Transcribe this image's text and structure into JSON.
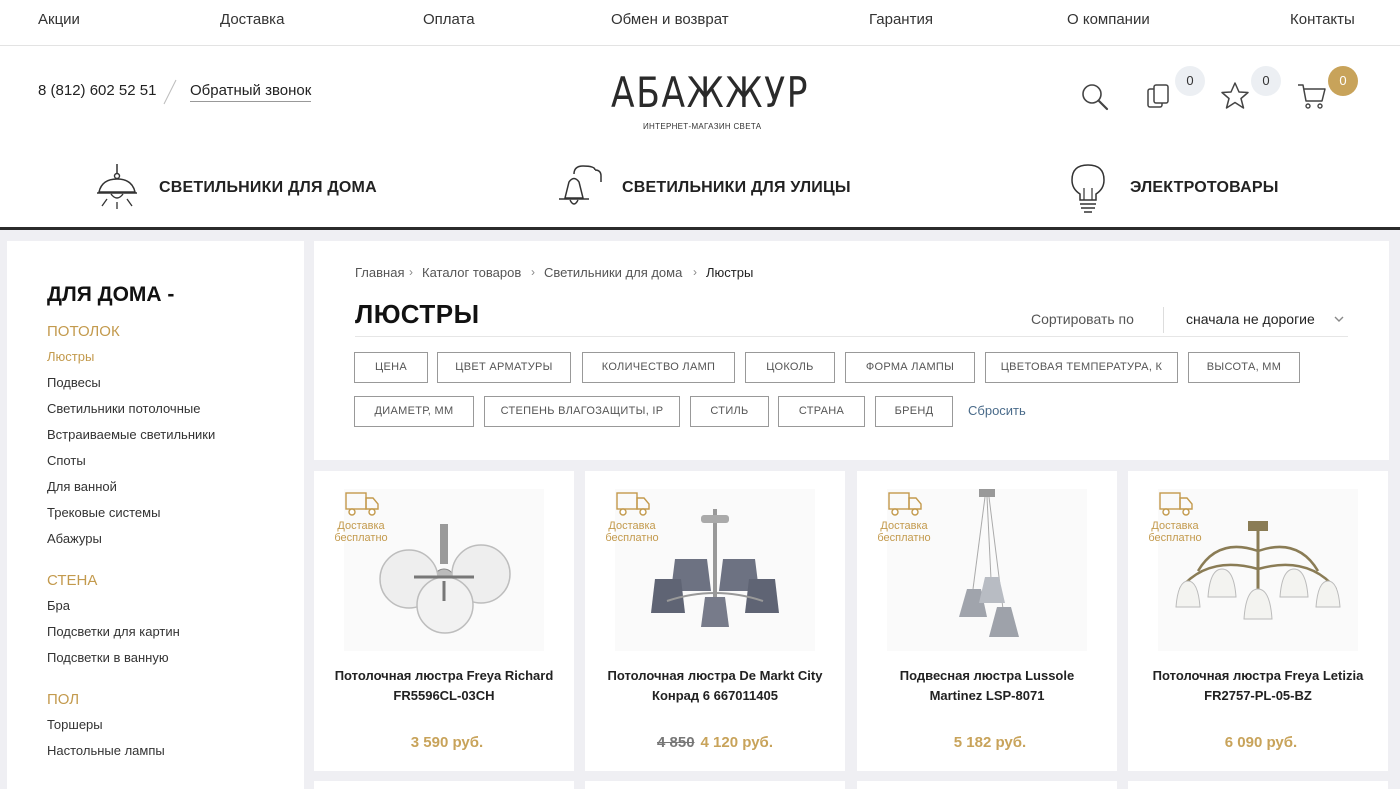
{
  "topnav": [
    "Акции",
    "Доставка",
    "Оплата",
    "Обмен и возврат",
    "Гарантия",
    "О компании",
    "Контакты"
  ],
  "header": {
    "phone": "8 (812) 602 52 51",
    "callback": "Обратный звонок",
    "logo_title": "АБАЖЖУР",
    "logo_subtitle": "ИНТЕРНЕТ-МАГАЗИН СВЕТА",
    "compare_count": "0",
    "favorites_count": "0",
    "cart_count": "0"
  },
  "categories": [
    "СВЕТИЛЬНИКИ ДЛЯ ДОМА",
    "СВЕТИЛЬНИКИ ДЛЯ УЛИЦЫ",
    "ЭЛЕКТРОТОВАРЫ"
  ],
  "sidebar": {
    "title": "ДЛЯ ДОМА  -",
    "sections": [
      {
        "title": "ПОТОЛОК",
        "items": [
          "Люстры",
          "Подвесы",
          "Светильники потолочные",
          "Встраиваемые светильники",
          "Споты",
          "Для ванной",
          "Трековые системы",
          "Абажуры"
        ]
      },
      {
        "title": "СТЕНА",
        "items": [
          "Бра",
          "Подсветки для картин",
          "Подсветки в ванную"
        ]
      },
      {
        "title": "ПОЛ",
        "items": [
          "Торшеры",
          "Настольные лампы"
        ]
      }
    ],
    "active_item": "Люстры"
  },
  "breadcrumbs": [
    "Главная",
    "Каталог товаров",
    "Светильники для дома",
    "Люстры"
  ],
  "page_title": "ЛЮСТРЫ",
  "sort": {
    "label": "Сортировать по",
    "value": "сначала не дорогие"
  },
  "filters_row1": [
    "ЦЕНА",
    "ЦВЕТ АРМАТУРЫ",
    "КОЛИЧЕСТВО ЛАМП",
    "ЦОКОЛЬ",
    "ФОРМА ЛАМПЫ",
    "ЦВЕТОВАЯ ТЕМПЕРАТУРА, К",
    "ВЫСОТА, ММ"
  ],
  "filters_row2": [
    "ДИАМЕТР, ММ",
    "СТЕПЕНЬ ВЛАГОЗАЩИТЫ, IP",
    "СТИЛЬ",
    "СТРАНА",
    "БРЕНД"
  ],
  "reset": "Сбросить",
  "delivery_badge": "Доставка бесплатно",
  "products": [
    {
      "name": "Потолочная люстра Freya Richard FR5596CL-03CH",
      "price": "3 590 руб.",
      "old_price": ""
    },
    {
      "name": "Потолочная люстра De Markt City Конрад 6 667011405",
      "price": "4 120 руб.",
      "old_price": "4 850"
    },
    {
      "name": "Подвесная люстра Lussole Martinez LSP-8071",
      "price": "5 182 руб.",
      "old_price": ""
    },
    {
      "name": "Потолочная люстра Freya Letizia FR2757-PL-05-BZ",
      "price": "6 090 руб.",
      "old_price": ""
    }
  ]
}
